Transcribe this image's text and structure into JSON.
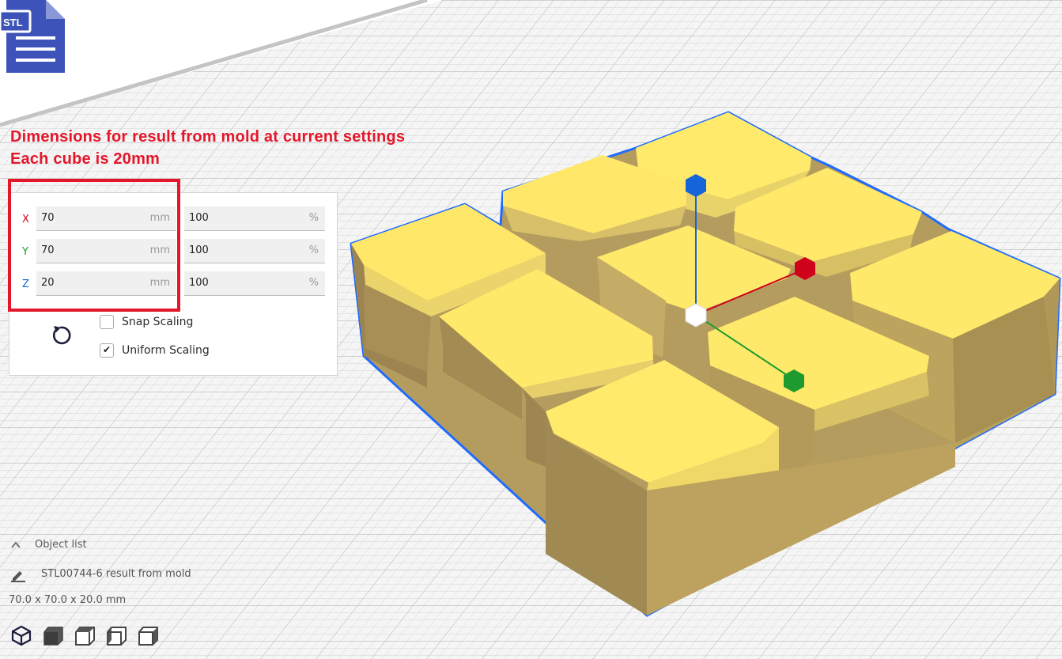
{
  "file_icon": {
    "label": "STL",
    "icon": "stl-file-icon",
    "color": "#3d53b9"
  },
  "annotations": {
    "line1": "Dimensions for result from mold at current settings",
    "line2": "Each cube is 20mm",
    "color": "#e4162a"
  },
  "scale_panel": {
    "axes": [
      {
        "axis": "X",
        "value": "70",
        "unit": "mm",
        "percent": "100",
        "percent_unit": "%",
        "color": "#d0021b"
      },
      {
        "axis": "Y",
        "value": "70",
        "unit": "mm",
        "percent": "100",
        "percent_unit": "%",
        "color": "#1f9a2e"
      },
      {
        "axis": "Z",
        "value": "20",
        "unit": "mm",
        "percent": "100",
        "percent_unit": "%",
        "color": "#1565d8"
      }
    ],
    "snap_scaling": {
      "label": "Snap Scaling",
      "checked": false
    },
    "uniform_scaling": {
      "label": "Uniform Scaling",
      "checked": true
    },
    "reset_icon": "reset-icon"
  },
  "object_list": {
    "header": "Object list",
    "object_name": "STL00744-6 result from mold",
    "dimensions": "70.0 x 70.0 x 20.0 mm"
  },
  "view_buttons": [
    "3d-view-icon",
    "front-view-icon",
    "top-view-icon",
    "left-view-icon",
    "right-view-icon"
  ],
  "model": {
    "fill_top": "#ffea6b",
    "fill_side": "#a68f57",
    "outline": "#1f6bff"
  },
  "gizmo": {
    "x_color": "#d0021b",
    "y_color": "#1f9a2e",
    "z_color": "#1565d8"
  }
}
